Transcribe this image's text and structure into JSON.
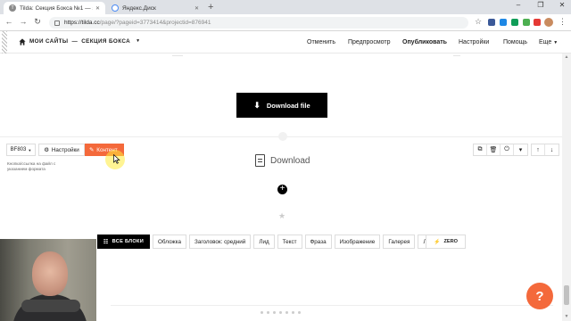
{
  "browser": {
    "tabs": [
      {
        "title": "Tilda: Секция Бокса №1 — зан",
        "active": true
      },
      {
        "title": "Яндекс.Диск",
        "active": false
      }
    ],
    "new_tab": "+",
    "url_host": "https://tilda.cc",
    "url_rest": "/page/?pageid=3773414&projectid=876941",
    "window_controls": [
      "–",
      "❐",
      "✕"
    ]
  },
  "tilda_panel": {
    "breadcrumb_sites": "МОИ САЙТЫ",
    "breadcrumb_sep": "—",
    "breadcrumb_project": "СЕКЦИЯ БОКСА",
    "menu": {
      "undo": "Отменить",
      "preview": "Предпросмотр",
      "publish": "Опубликовать",
      "settings": "Настройки",
      "help": "Помощь",
      "more": "Еще"
    }
  },
  "download_button": {
    "label": "Download file"
  },
  "block_toolbar": {
    "block_id": "BF803",
    "settings": "Настройки",
    "content": "Контент",
    "description": "Кнопка/ссылка на файл с указанием формата"
  },
  "file_block": {
    "label": "Download"
  },
  "library": {
    "all_blocks": "ВСЕ БЛОКИ",
    "categories": [
      "Обложка",
      "Заголовок: средний",
      "Лид",
      "Текст",
      "Фраза",
      "Изображение",
      "Галерея",
      "Линия"
    ],
    "zero": "ZERO"
  },
  "help_button": {
    "label": "?"
  },
  "colors": {
    "accent": "#f4693b",
    "dark": "#000000",
    "chrome_bg": "#dee1e6"
  }
}
